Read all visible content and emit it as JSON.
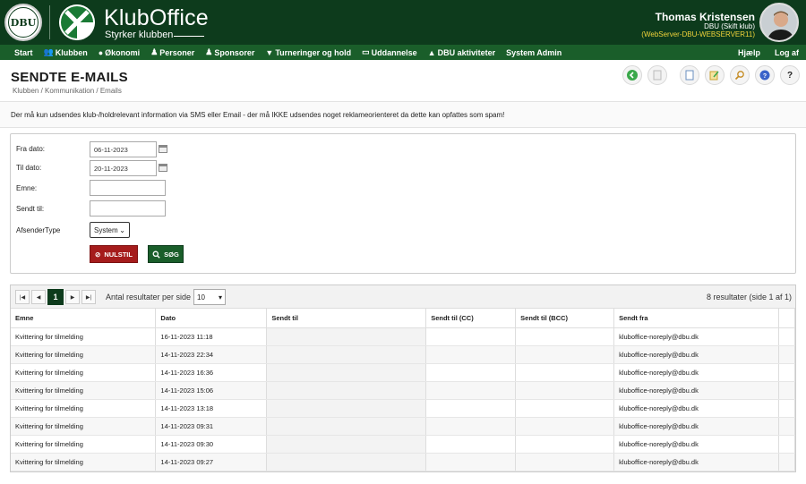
{
  "header": {
    "dbu_logo_text": "DBU",
    "brand_title": "KlubOffice",
    "brand_subtitle": "Styrker klubben",
    "user_name": "Thomas Kristensen",
    "user_club": "DBU (Skift klub)",
    "server": "(WebServer-DBU-WEBSERVER11)"
  },
  "nav": {
    "items": [
      "Start",
      "Klubben",
      "Økonomi",
      "Personer",
      "Sponsorer",
      "Turneringer og hold",
      "Uddannelse",
      "DBU aktiviteter",
      "System Admin"
    ],
    "right_items": [
      "Hjælp",
      "Log af"
    ]
  },
  "page": {
    "title": "SENDTE E-MAILS",
    "breadcrumb": "Klubben / Kommunikation / Emails"
  },
  "info": "Der må kun udsendes klub-/holdrelevant information via SMS eller Email - der må IKKE udsendes noget reklameorienteret da dette kan opfattes som spam!",
  "form": {
    "from_label": "Fra dato:",
    "from_value": "06-11-2023",
    "to_label": "Til dato:",
    "to_value": "20-11-2023",
    "subject_label": "Emne:",
    "subject_value": "",
    "sent_to_label": "Sendt til:",
    "sent_to_value": "",
    "sender_type_label": "AfsenderType",
    "sender_type_value": "System",
    "reset_label": "NULSTIL",
    "search_label": "SØG"
  },
  "pager": {
    "current_page": "1",
    "per_page_label": "Antal resultater per side",
    "per_page_value": "10",
    "results_info": "8 resultater (side 1 af 1)"
  },
  "table": {
    "headers": [
      "Emne",
      "Dato",
      "Sendt til",
      "Sendt til (CC)",
      "Sendt til (BCC)",
      "Sendt fra"
    ],
    "rows": [
      [
        "Kvittering for tilmelding",
        "16-11-2023 11:18",
        "",
        "",
        "",
        "kluboffice-noreply@dbu.dk"
      ],
      [
        "Kvittering for tilmelding",
        "14-11-2023 22:34",
        "",
        "",
        "",
        "kluboffice-noreply@dbu.dk"
      ],
      [
        "Kvittering for tilmelding",
        "14-11-2023 16:36",
        "",
        "",
        "",
        "kluboffice-noreply@dbu.dk"
      ],
      [
        "Kvittering for tilmelding",
        "14-11-2023 15:06",
        "",
        "",
        "",
        "kluboffice-noreply@dbu.dk"
      ],
      [
        "Kvittering for tilmelding",
        "14-11-2023 13:18",
        "",
        "",
        "",
        "kluboffice-noreply@dbu.dk"
      ],
      [
        "Kvittering for tilmelding",
        "14-11-2023 09:31",
        "",
        "",
        "",
        "kluboffice-noreply@dbu.dk"
      ],
      [
        "Kvittering for tilmelding",
        "14-11-2023 09:30",
        "",
        "",
        "",
        "kluboffice-noreply@dbu.dk"
      ],
      [
        "Kvittering for tilmelding",
        "14-11-2023 09:27",
        "",
        "",
        "",
        "kluboffice-noreply@dbu.dk"
      ]
    ]
  },
  "colors": {
    "header_bg": "#0d3b1c",
    "nav_bg": "#1a5e2a",
    "reset_button": "#a51c1c",
    "search_button": "#1a5e2a",
    "server_text": "#f0d33a"
  }
}
